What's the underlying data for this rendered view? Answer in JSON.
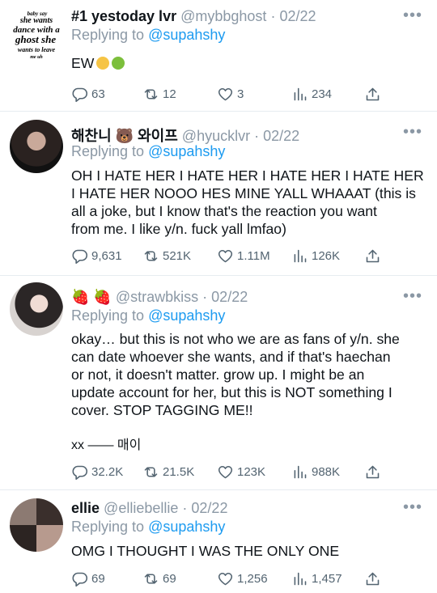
{
  "tweets": [
    {
      "name": "#1 yestoday lvr",
      "handle": "@mybbghost",
      "date": "02/22",
      "reply_prefix": "Replying to",
      "reply_to": "@supahshy",
      "text": "EW",
      "avatar_text": [
        "baby say",
        "she wants",
        "dance with a",
        "ghost she",
        "wants to leave",
        "me uh"
      ],
      "counts": {
        "replies": "63",
        "retweets": "12",
        "likes": "3",
        "views": "234"
      }
    },
    {
      "name": "해찬니 🐻 와이프",
      "handle": "@hyucklvr",
      "date": "02/22",
      "reply_prefix": "Replying to",
      "reply_to": "@supahshy",
      "text_lines": [
        "OH I HATE HER I HATE HER I HATE HER I HATE HER",
        "I HATE HER NOOO HES MINE YALL WHAAAT (this is",
        "all a joke, but I know that's the reaction you want",
        "from me. I like y/n. fuck yall lmfao)"
      ],
      "counts": {
        "replies": "9,631",
        "retweets": "521K",
        "likes": "1.11M",
        "views": "126K"
      }
    },
    {
      "name": "🍓 🍓",
      "handle": "@strawbkiss",
      "date": "02/22",
      "reply_prefix": "Replying to",
      "reply_to": "@supahshy",
      "text_lines": [
        "okay… but this is not who we are as fans of y/n. she",
        "can date whoever she wants, and if that's haechan",
        "or not, it doesn't matter. grow up. I might be an",
        "update account for her, but this is NOT something I",
        "cover. STOP TAGGING ME!!"
      ],
      "signature": "xx —— 매이",
      "counts": {
        "replies": "32.2K",
        "retweets": "21.5K",
        "likes": "123K",
        "views": "988K"
      }
    },
    {
      "name": "ellie",
      "handle": "@elliebellie",
      "date": "02/22",
      "reply_prefix": "Replying to",
      "reply_to": "@supahshy",
      "text": "OMG I THOUGHT I WAS THE ONLY ONE",
      "counts": {
        "replies": "69",
        "retweets": "69",
        "likes": "1,256",
        "views": "1,457"
      }
    }
  ],
  "ui": {
    "more": "•••",
    "date_sep": "·"
  },
  "colors": {
    "muted": "#8b98a5",
    "link": "#1d9bf0",
    "icon": "#536471"
  }
}
